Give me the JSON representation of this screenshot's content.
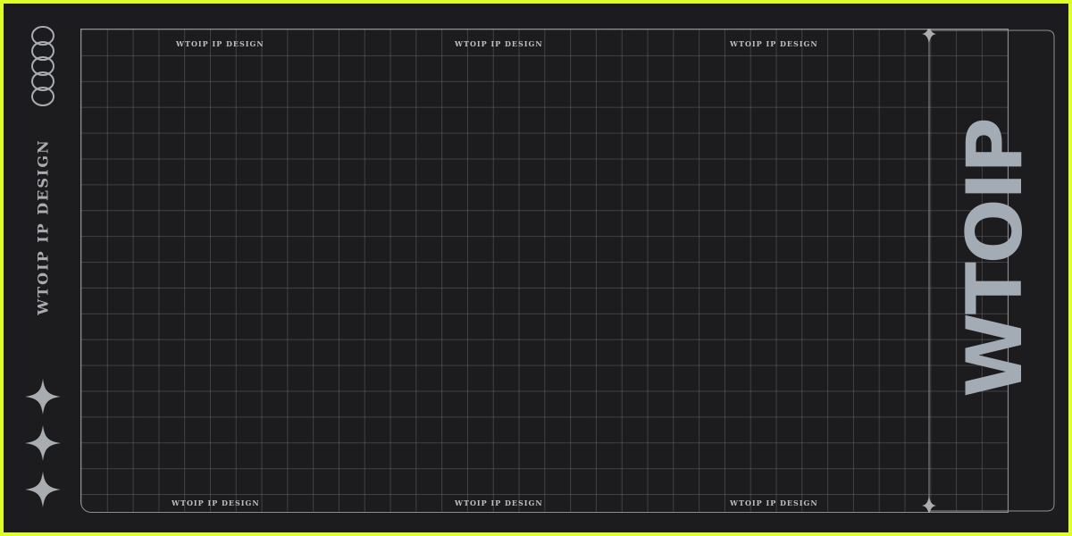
{
  "poster": {
    "side_title": "WTOIP IP DESIGN",
    "big_word": "WTOIP",
    "grid_captions_top": [
      "WTOIP IP DESIGN",
      "WTOIP IP DESIGN",
      "WTOIP IP DESIGN"
    ],
    "grid_captions_bottom": [
      "WTOIP IP DESIGN",
      "WTOIP IP DESIGN",
      "WTOIP IP DESIGN"
    ]
  },
  "icons": {
    "logo": "interlocking-rings-icon",
    "sparkles": [
      "sparkle-icon",
      "sparkle-icon",
      "sparkle-icon"
    ]
  },
  "colors": {
    "frame": "#dfff2a",
    "background": "#1c1c1e",
    "text": "#a3abb5",
    "grid_line": "#8f8f8f"
  }
}
